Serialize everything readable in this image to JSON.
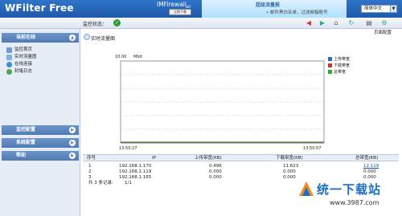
{
  "app": {
    "title": "WFilter Free",
    "language": "简体中文"
  },
  "ad": {
    "title": "超级流量报",
    "subtitle": "• 邮件黑白名单，过滤邮箱账号",
    "brand": "IMFirewall",
    "button": "立即下载",
    "extra": "all"
  },
  "toolbar": {
    "status_label": "监控状态：",
    "status_icon": "check-icon",
    "page_config": "页面配置"
  },
  "sidebar": {
    "sections": [
      {
        "label": "当前在线",
        "expanded": true
      },
      {
        "label": "监控配置",
        "expanded": false
      },
      {
        "label": "系统配置",
        "expanded": false
      },
      {
        "label": "帮助",
        "expanded": false
      }
    ],
    "items": [
      {
        "label": "监控首页",
        "icon": "monitor-icon",
        "color": "#6f9ed6"
      },
      {
        "label": "实时流量图",
        "icon": "chart-icon",
        "color": "#7fb2e5"
      },
      {
        "label": "在线连接",
        "icon": "globe-icon",
        "color": "#3b8fd6"
      },
      {
        "label": "封堵日志",
        "icon": "log-icon",
        "color": "#4aa84a"
      }
    ]
  },
  "main": {
    "title": "实时流量图"
  },
  "chart_data": {
    "type": "line",
    "title": "",
    "ylabel": "",
    "y_top_label": "10.00",
    "y_unit": "Mbit",
    "ylim": [
      0,
      10
    ],
    "x_start_label": "13:50:27",
    "x_end_label": "13:50:57",
    "grid": "dotted horizontal",
    "series": [
      {
        "name": "上传带宽",
        "color": "#3366cc",
        "values": [
          0,
          0,
          0,
          0,
          0,
          0,
          0
        ]
      },
      {
        "name": "下载带宽",
        "color": "#cc3333",
        "values": [
          0,
          0,
          0,
          0,
          0,
          0,
          0
        ]
      },
      {
        "name": "总带宽",
        "color": "#33aa33",
        "values": [
          0,
          0,
          0,
          0,
          0,
          0,
          0
        ]
      }
    ]
  },
  "table": {
    "headers": [
      "序号",
      "IP",
      "上传带宽(KB)",
      "下载带宽(KB)",
      "总带宽(KB)"
    ],
    "rows": [
      [
        "1",
        "192.168.1.170",
        "0.496",
        "11.623",
        "12.119"
      ],
      [
        "2",
        "192.168.1.119",
        "0.000",
        "0.000",
        "0.000"
      ],
      [
        "3",
        "192.168.1.165",
        "0.000",
        "0.000",
        "0.000"
      ]
    ],
    "summary_label": "共 3 条记录:",
    "summary_pages": "1/1"
  },
  "watermark": {
    "text": "统一下载站",
    "url": "www.3987.com"
  }
}
